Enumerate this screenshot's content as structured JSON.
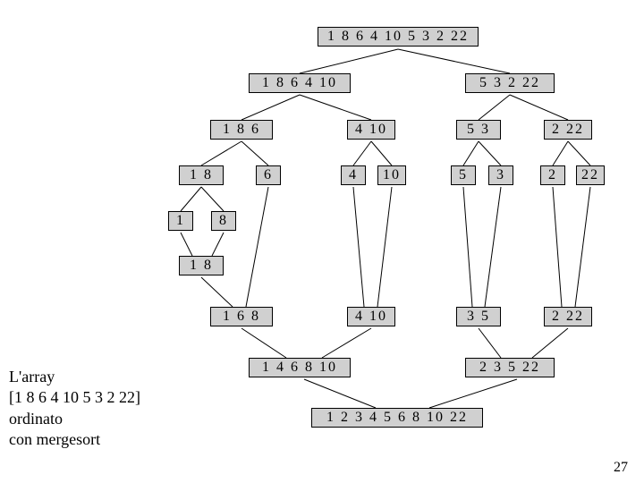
{
  "caption": {
    "line1": "L'array",
    "line2": "[1 8 6 4 10 5 3 2 22]",
    "line3": "ordinato",
    "line4": "con mergesort"
  },
  "page_number": "27",
  "nodes": {
    "root": "1  8  6  4 10  5  3  2  22",
    "l": "1  8  6  4 10",
    "r": "5  3  2  22",
    "ll": "1  8  6",
    "lr": "4 10",
    "rl": "5  3",
    "rr": "2 22",
    "lll": "1  8",
    "llr": "6",
    "lrl": "4",
    "lrr": "10",
    "rll": "5",
    "rlr": "3",
    "rrl": "2",
    "rrr": "22",
    "llll": "1",
    "lllr": "8",
    "lll_m": "1  8",
    "ll_m": "1  6  8",
    "lr_m": "4 10",
    "rl_m": "3  5",
    "rr_m": "2 22",
    "l_m": "1  4  6  8 10",
    "r_m": "2  3  5  22",
    "root_m": "1  2  3  4  5  6  8  10  22"
  }
}
